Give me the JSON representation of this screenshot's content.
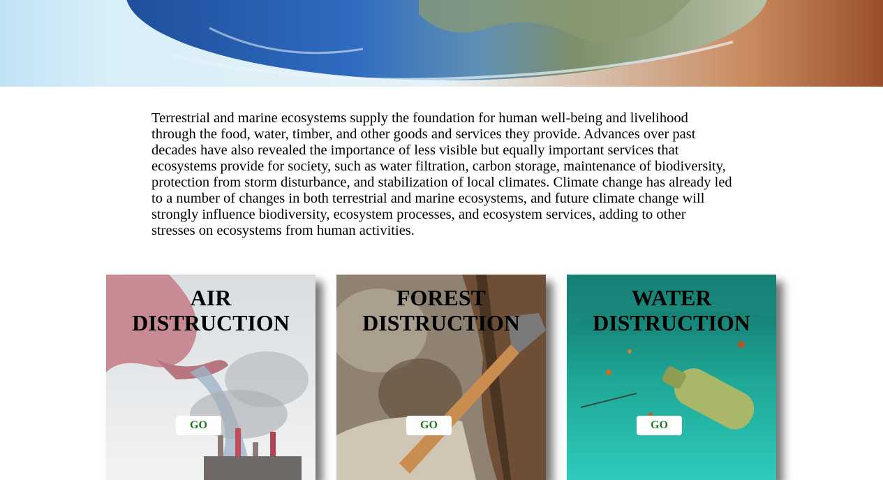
{
  "intro": {
    "text": "Terrestrial and marine ecosystems supply the foundation for human well-being and livelihood through the food, water, timber, and other goods and services they provide. Advances over past decades have also revealed the importance of less visible but equally important services that ecosystems provide for society, such as water filtration, carbon storage, maintenance of biodiversity, protection from storm disturbance, and stabilization of local climates. Climate change has already led to a number of changes in both terrestrial and marine ecosystems, and future climate change will strongly influence biodiversity, ecosystem processes, and ecosystem services, adding to other stresses on ecosystems from human activities."
  },
  "cards": [
    {
      "title_line1": "AIR",
      "title_line2": "DISTRUCTION",
      "button_label": "GO"
    },
    {
      "title_line1": "FOREST",
      "title_line2": "DISTRUCTION",
      "button_label": "GO"
    },
    {
      "title_line1": "WATER",
      "title_line2": "DISTRUCTION",
      "button_label": "GO"
    }
  ],
  "colors": {
    "button_text": "#1f7a1f",
    "button_bg": "#ffffff"
  }
}
